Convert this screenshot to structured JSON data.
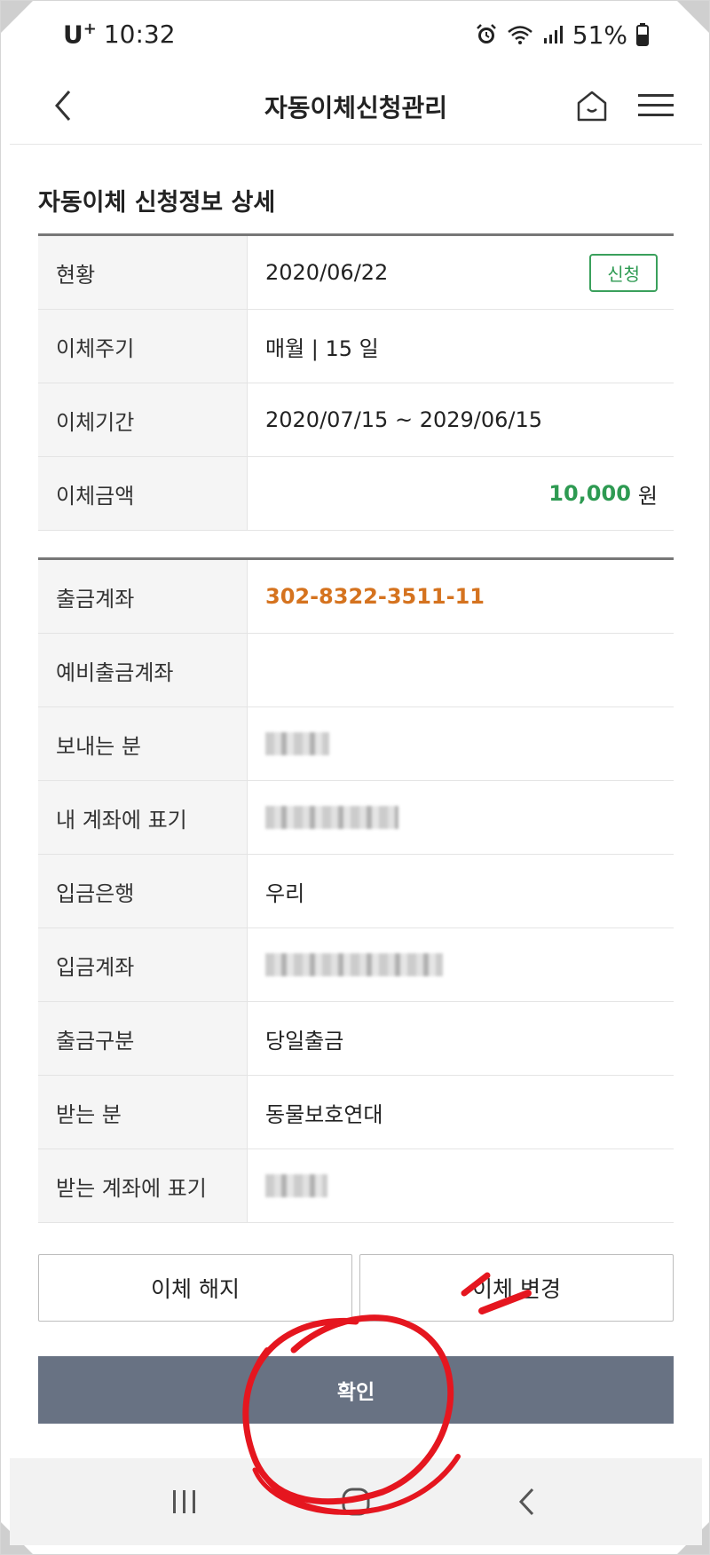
{
  "status_bar": {
    "carrier": "U",
    "carrier_sup": "+",
    "time": "10:32",
    "battery": "51%",
    "icons": [
      "alarm-icon",
      "wifi-icon",
      "signal-icon",
      "battery-icon"
    ]
  },
  "header": {
    "title": "자동이체신청관리",
    "back_icon": "chevron-left-icon",
    "home_icon": "home-icon",
    "menu_icon": "hamburger-menu-icon"
  },
  "section_title": "자동이체 신청정보 상세",
  "summary": {
    "status_label": "현황",
    "status_date": "2020/06/22",
    "status_badge": "신청",
    "cycle_label": "이체주기",
    "cycle_value": "매월 | 15 일",
    "period_label": "이체기간",
    "period_value": "2020/07/15 ~ 2029/06/15",
    "amount_label": "이체금액",
    "amount_value": "10,000",
    "amount_unit": "원"
  },
  "details": {
    "withdraw_label": "출금계좌",
    "withdraw_value": "302-8322-3511-11",
    "backup_label": "예비출금계좌",
    "backup_value": "",
    "sender_label": "보내는 분",
    "my_memo_label": "내 계좌에 표기",
    "bank_label": "입금은행",
    "bank_value": "우리",
    "deposit_account_label": "입금계좌",
    "withdraw_type_label": "출금구분",
    "withdraw_type_value": "당일출금",
    "recipient_label": "받는 분",
    "recipient_value": "동물보호연대",
    "recipient_memo_label": "받는 계좌에 표기"
  },
  "buttons": {
    "cancel": "이체 해지",
    "change": "이체 변경",
    "confirm": "확인"
  },
  "nav": {
    "recent_icon": "recent-apps-icon",
    "home_icon": "home-circle-icon",
    "back_icon": "back-icon"
  },
  "colors": {
    "accent_green": "#2e9a52",
    "account_orange": "#d5731f",
    "confirm_bg": "#687283",
    "markup_red": "#e5161f"
  }
}
